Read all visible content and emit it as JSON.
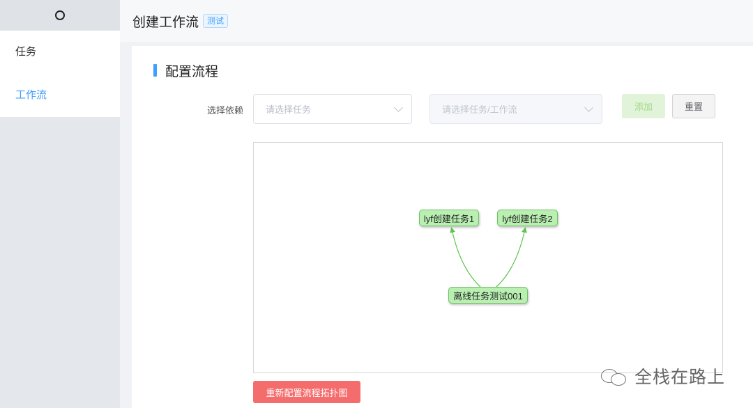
{
  "sidebar": {
    "logo_icon": "ring-icon",
    "items": [
      {
        "label": "任务",
        "active": false
      },
      {
        "label": "工作流",
        "active": true
      }
    ]
  },
  "header": {
    "title": "创建工作流",
    "tag": "测试"
  },
  "section": {
    "title": "配置流程"
  },
  "form": {
    "label": "选择依赖",
    "task_select_placeholder": "请选择任务",
    "target_select_placeholder": "请选择任务/工作流",
    "add_label": "添加",
    "reset_label": "重置"
  },
  "graph": {
    "nodes": [
      {
        "id": "n1",
        "label": "lyf创建任务1"
      },
      {
        "id": "n2",
        "label": "lyf创建任务2"
      },
      {
        "id": "n3",
        "label": "离线任务测试001"
      }
    ],
    "edges": [
      {
        "from": "n3",
        "to": "n1"
      },
      {
        "from": "n3",
        "to": "n2"
      }
    ],
    "node_color": "#b9f0b2",
    "edge_color": "#5fc44f"
  },
  "actions": {
    "regenerate_label": "重新配置流程拓扑图"
  },
  "watermark": {
    "text": "全栈在路上"
  },
  "colors": {
    "accent": "#409eff",
    "danger": "#f56c6c",
    "success_light": "#e1f3d8"
  }
}
